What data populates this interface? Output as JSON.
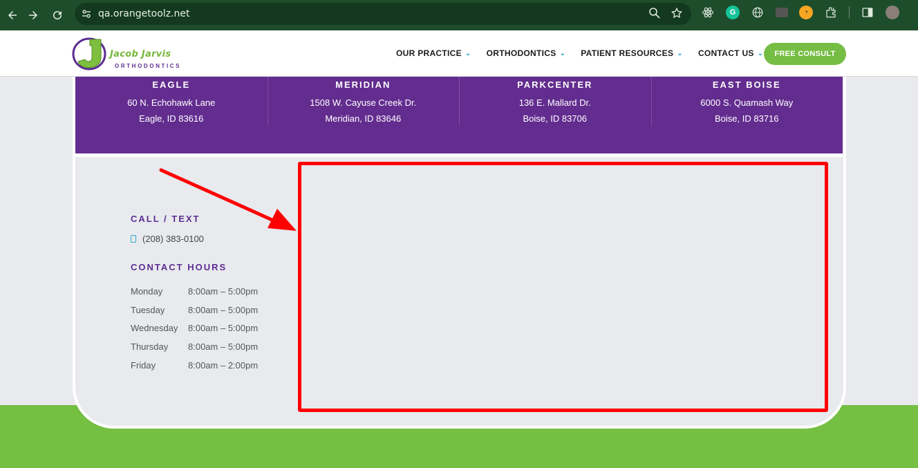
{
  "browser": {
    "url": "qa.orangetoolz.net"
  },
  "header": {
    "logo_name": "Jacob Jarvis",
    "logo_sub": "ORTHODONTICS",
    "nav": [
      {
        "label": "OUR PRACTICE"
      },
      {
        "label": "ORTHODONTICS"
      },
      {
        "label": "PATIENT RESOURCES"
      },
      {
        "label": "CONTACT US"
      }
    ],
    "cta_label": "FREE CONSULT"
  },
  "locations": [
    {
      "name": "EAGLE",
      "street": "60 N. Echohawk Lane",
      "city": "Eagle, ID 83616"
    },
    {
      "name": "MERIDIAN",
      "street": "1508 W. Cayuse Creek Dr.",
      "city": "Meridian, ID 83646"
    },
    {
      "name": "PARKCENTER",
      "street": "136 E. Mallard Dr.",
      "city": "Boise, ID 83706"
    },
    {
      "name": "EAST BOISE",
      "street": "6000 S. Quamash Way",
      "city": "Boise, ID 83716"
    }
  ],
  "contact": {
    "call_heading": "CALL / TEXT",
    "phone": "(208) 383-0100",
    "hours_heading": "CONTACT HOURS",
    "hours": [
      {
        "day": "Monday",
        "time": "8:00am – 5:00pm"
      },
      {
        "day": "Tuesday",
        "time": "8:00am – 5:00pm"
      },
      {
        "day": "Wednesday",
        "time": "8:00am – 5:00pm"
      },
      {
        "day": "Thursday",
        "time": "8:00am – 5:00pm"
      },
      {
        "day": "Friday",
        "time": "8:00am – 2:00pm"
      }
    ]
  },
  "colors": {
    "brand_purple": "#632d8f",
    "brand_green": "#75bf43",
    "annotation_red": "#ff0000"
  }
}
